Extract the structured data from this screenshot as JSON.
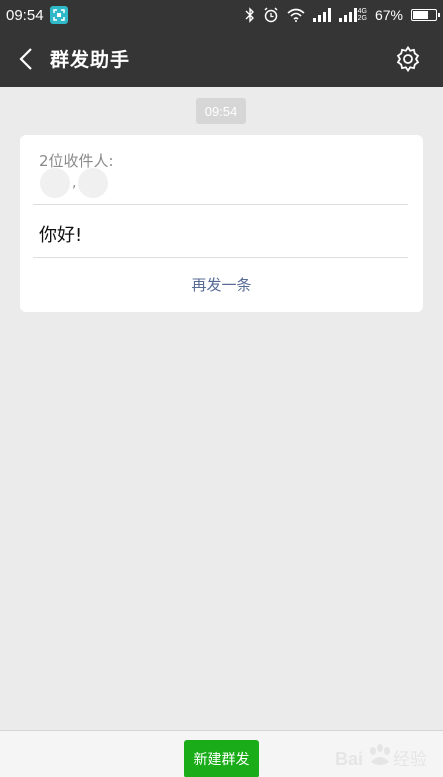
{
  "status_bar": {
    "time": "09:54",
    "network_label_top": "4G",
    "network_label_bottom": "2G",
    "battery": "67%",
    "battery_level": 0.67
  },
  "header": {
    "title": "群发助手"
  },
  "chat": {
    "timestamp": "09:54",
    "card": {
      "recipients_label": "2位收件人:",
      "recipients_separator": ", ",
      "message": "你好!",
      "resend_label": "再发一条"
    }
  },
  "footer": {
    "new_broadcast_label": "新建群发"
  },
  "watermark": {
    "text": "Bai经验"
  },
  "colors": {
    "bar": "#353535",
    "background": "#ebebeb",
    "primary_green": "#1aad19",
    "link_blue": "#576b95",
    "scan_badge": "#2eb8c8"
  },
  "icons": [
    "scan-icon",
    "bluetooth-icon",
    "alarm-icon",
    "wifi-icon",
    "signal-icon",
    "battery-icon",
    "back-arrow-icon",
    "gear-icon"
  ]
}
